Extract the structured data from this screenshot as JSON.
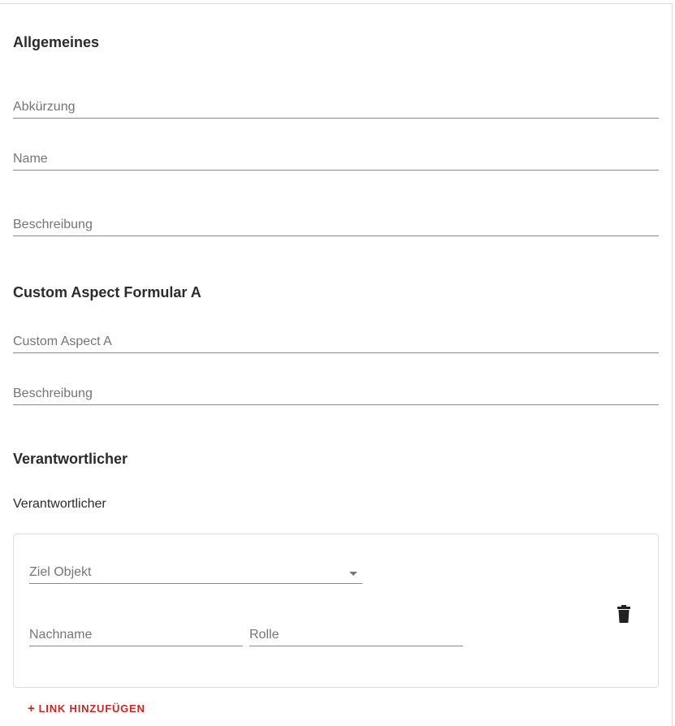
{
  "sections": {
    "general": {
      "title": "Allgemeines",
      "abbreviation_label": "Abkürzung",
      "name_label": "Name",
      "description_label": "Beschreibung"
    },
    "custom_aspect": {
      "title": "Custom Aspect Formular A",
      "field_label": "Custom Aspect A",
      "description_label": "Beschreibung"
    },
    "responsible": {
      "title": "Verantwortlicher",
      "label": "Verantwortlicher",
      "link": {
        "target_label": "Ziel Objekt",
        "lastname_label": "Nachname",
        "role_label": "Rolle"
      },
      "add_link_label": "LINK HINZUFÜGEN",
      "add_link_icon": "plus-icon",
      "delete_icon": "trash-icon"
    }
  },
  "colors": {
    "accent": "#c62828",
    "label": "#757575",
    "underline": "#8a8a8a"
  }
}
